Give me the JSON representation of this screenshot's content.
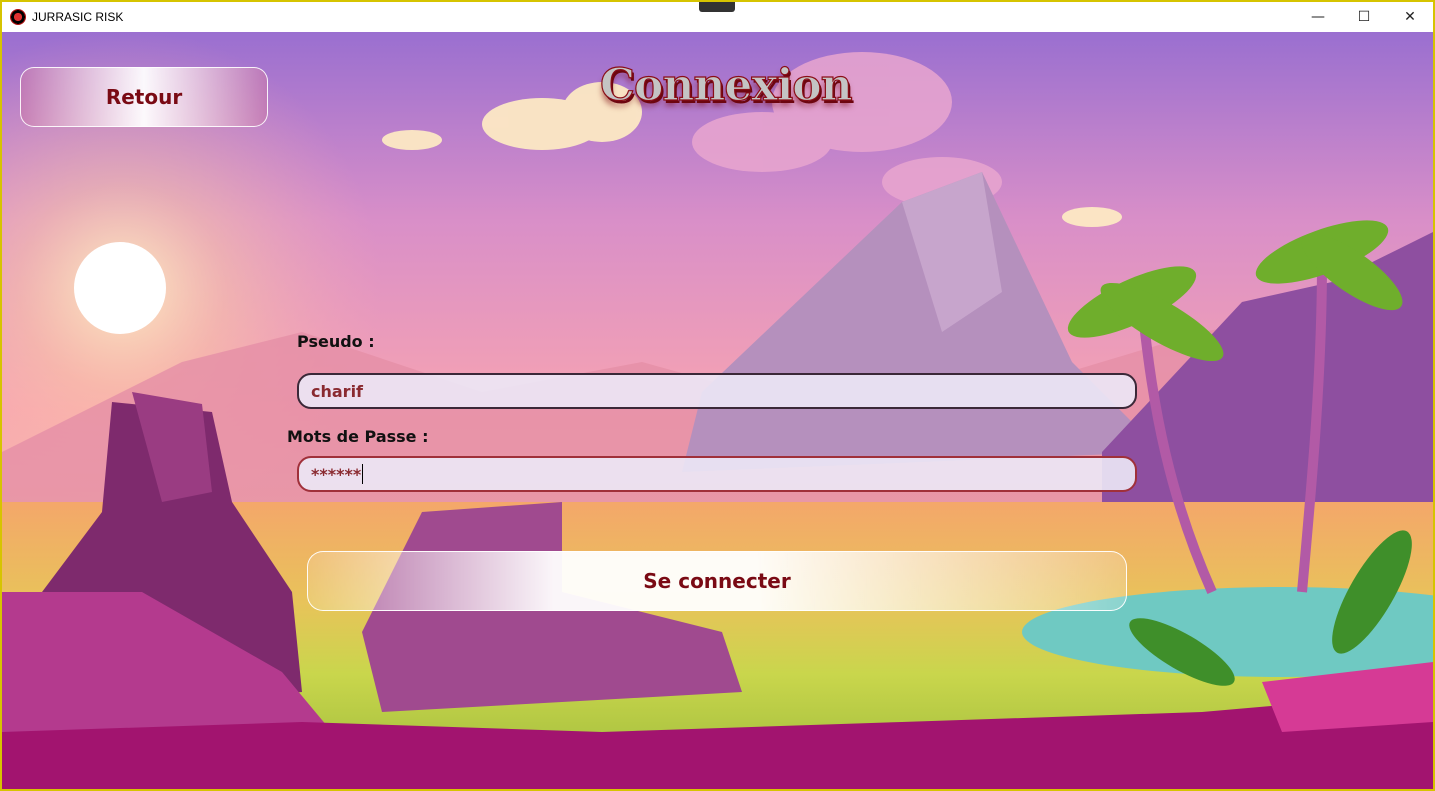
{
  "window": {
    "title": "JURRASIC RISK"
  },
  "controls": {
    "minimize": "—",
    "maximize": "☐",
    "close": "✕"
  },
  "header": {
    "back_label": "Retour",
    "title": "Connexion"
  },
  "form": {
    "pseudo_label": "Pseudo :",
    "pseudo_value": "charif",
    "password_label": "Mots de Passe :",
    "password_value": "******",
    "submit_label": "Se connecter"
  },
  "colors": {
    "accent": "#7a0a14",
    "window_border": "#d6c400",
    "sky_top": "#9a6fd0",
    "sky_mid": "#f5a0b0"
  }
}
